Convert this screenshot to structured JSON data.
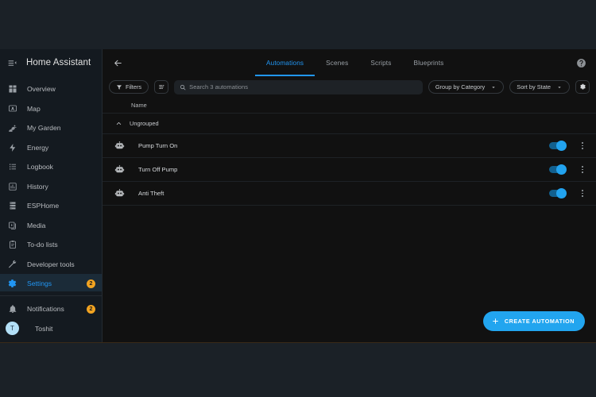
{
  "sidebar": {
    "app_title": "Home Assistant",
    "menu_icon": "menu-open-icon",
    "items": [
      {
        "label": "Overview",
        "icon": "view-dashboard-icon",
        "active": false,
        "badge": ""
      },
      {
        "label": "Map",
        "icon": "map-marker-icon",
        "active": false,
        "badge": ""
      },
      {
        "label": "My Garden",
        "icon": "sprout-icon",
        "active": false,
        "badge": ""
      },
      {
        "label": "Energy",
        "icon": "lightning-bolt-icon",
        "active": false,
        "badge": ""
      },
      {
        "label": "Logbook",
        "icon": "format-list-bulleted-icon",
        "active": false,
        "badge": ""
      },
      {
        "label": "History",
        "icon": "chart-box-icon",
        "active": false,
        "badge": ""
      },
      {
        "label": "ESPHome",
        "icon": "server-icon",
        "active": false,
        "badge": ""
      },
      {
        "label": "Media",
        "icon": "play-box-multiple-icon",
        "active": false,
        "badge": ""
      },
      {
        "label": "To-do lists",
        "icon": "clipboard-list-icon",
        "active": false,
        "badge": ""
      },
      {
        "label": "Developer tools",
        "icon": "hammer-wrench-icon",
        "active": false,
        "badge": ""
      },
      {
        "label": "Settings",
        "icon": "cog-icon",
        "active": true,
        "badge": "2"
      }
    ],
    "footer": [
      {
        "label": "Notifications",
        "icon": "bell-icon",
        "badge": "2"
      }
    ],
    "user": {
      "name": "Toshit",
      "initial": "T"
    }
  },
  "topbar": {
    "back_icon": "arrow-left-icon",
    "help_icon": "help-circle-icon",
    "tabs": [
      {
        "label": "Automations",
        "active": true
      },
      {
        "label": "Scenes",
        "active": false
      },
      {
        "label": "Scripts",
        "active": false
      },
      {
        "label": "Blueprints",
        "active": false
      }
    ]
  },
  "toolbar": {
    "filters_label": "Filters",
    "filters_icon": "filter-icon",
    "sort_toggle_icon": "sort-variant-icon",
    "search": {
      "placeholder": "Search 3 automations",
      "value": "",
      "icon": "magnify-icon"
    },
    "group_by_label": "Group by Category",
    "sort_by_label": "Sort by State",
    "settings_icon": "cog-icon",
    "chevron_icon": "chevron-down-icon"
  },
  "table": {
    "column_header": "Name",
    "group": {
      "label": "Ungrouped",
      "collapse_icon": "chevron-up-icon",
      "expanded": true
    },
    "rows": [
      {
        "name": "Pump Turn On",
        "icon": "robot-icon",
        "enabled": true,
        "menu_icon": "dots-vertical-icon"
      },
      {
        "name": "Turn Off Pump",
        "icon": "robot-icon",
        "enabled": true,
        "menu_icon": "dots-vertical-icon"
      },
      {
        "name": "Anti Theft",
        "icon": "robot-icon",
        "enabled": true,
        "menu_icon": "dots-vertical-icon"
      }
    ]
  },
  "fab": {
    "label": "CREATE AUTOMATION",
    "icon": "plus-icon"
  },
  "colors": {
    "accent": "#22a5ef",
    "active_tab": "#2196f3",
    "badge": "#f1a321",
    "app_bg": "#111111",
    "sidebar_bg": "#141a20",
    "letterbox_bg": "#1b2127"
  }
}
